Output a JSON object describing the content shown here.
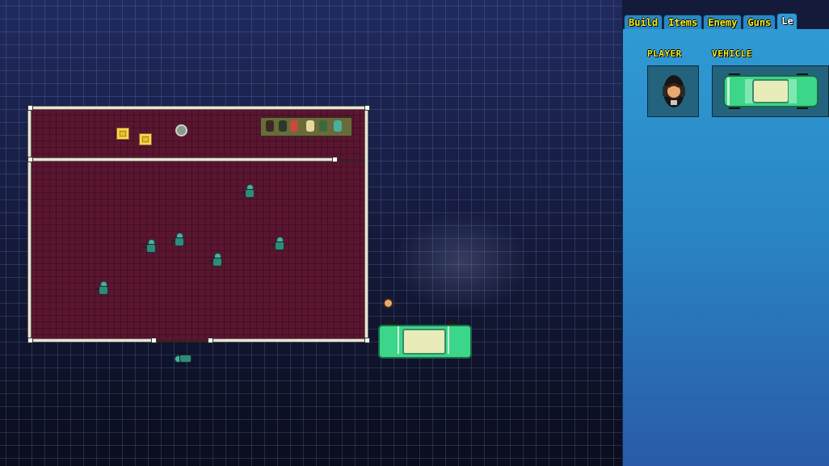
{
  "editor": {
    "canvas_name": "level-canvas",
    "tabs": [
      {
        "label": "Build"
      },
      {
        "label": "Items"
      },
      {
        "label": "Enemy"
      },
      {
        "label": "Guns"
      },
      {
        "label": "Le"
      }
    ],
    "active_tab": 4
  },
  "panel": {
    "player_label": "PLAYER",
    "vehicle_label": "VEHICLE",
    "player_icon": "player-character-icon",
    "vehicle_icon": "green-car-icon"
  },
  "colors": {
    "text_yellow": "#f4ef22",
    "panel_blue": "#2f9ad4",
    "floor": "#5a1530",
    "car_green": "#3bd68a",
    "enemy_teal": "#2f8a7a"
  }
}
